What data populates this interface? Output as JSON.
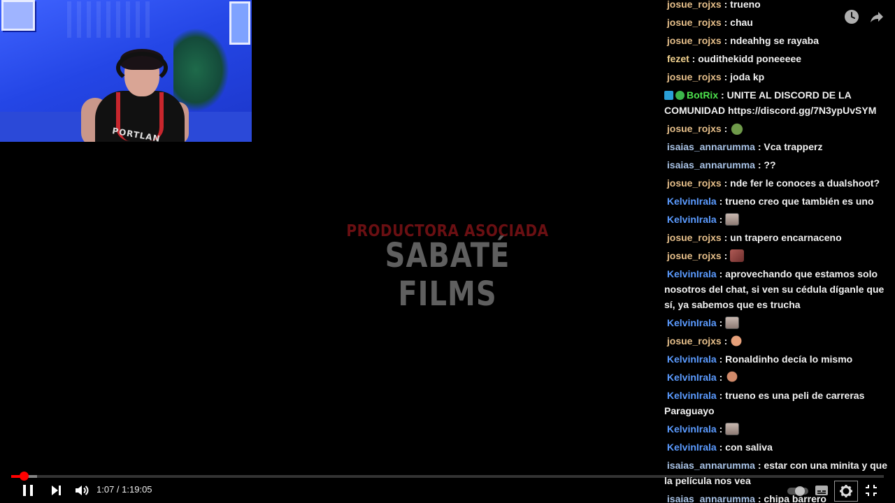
{
  "player": {
    "time_current": "1:07",
    "time_separator": " / ",
    "time_total": "1:19:05",
    "progress_played_fraction": 0.0147,
    "progress_loaded_fraction": 0.03
  },
  "video": {
    "logo_top": "PRODUCTORA ASOCIADA",
    "logo_main": "SABATÉ FILMS",
    "webcam_jersey_text": "PORTLAN"
  },
  "chat": {
    "messages": [
      {
        "user": "josue_rojxs",
        "user_color": "#e6bf8a",
        "text": "trueno"
      },
      {
        "user": "josue_rojxs",
        "user_color": "#e6bf8a",
        "text": "chau"
      },
      {
        "user": "josue_rojxs",
        "user_color": "#e6bf8a",
        "text": "ndeahhg se rayaba"
      },
      {
        "user": "fezet",
        "user_color": "#f2d28f",
        "text": "oudithekidd poneeeee"
      },
      {
        "user": "josue_rojxs",
        "user_color": "#e6bf8a",
        "text": "joda kp"
      },
      {
        "user": "BotRix",
        "user_color": "#4de34d",
        "text": "UNITE AL DISCORD DE LA COMUNIDAD https://discord.gg/7N3ypUvSYM",
        "badges": true
      },
      {
        "user": "josue_rojxs",
        "user_color": "#e6bf8a",
        "text": "",
        "emote": "frog"
      },
      {
        "user": "isaias_annarumma",
        "user_color": "#a9c3e6",
        "text": "Vca trapperz"
      },
      {
        "user": "isaias_annarumma",
        "user_color": "#a9c3e6",
        "text": "??"
      },
      {
        "user": "josue_rojxs",
        "user_color": "#e6bf8a",
        "text": "nde fer le conoces a dualshoot?"
      },
      {
        "user": "KelvinIrala",
        "user_color": "#5b9bff",
        "text": "trueno creo que también es uno"
      },
      {
        "user": "KelvinIrala",
        "user_color": "#5b9bff",
        "text": "",
        "emote": "face"
      },
      {
        "user": "josue_rojxs",
        "user_color": "#e6bf8a",
        "text": "un trapero encarnaceno"
      },
      {
        "user": "josue_rojxs",
        "user_color": "#e6bf8a",
        "text": "",
        "emote": "pixel"
      },
      {
        "user": "KelvinIrala",
        "user_color": "#5b9bff",
        "text": "aprovechando que estamos solo nosotros del chat, si ven su cédula díganle que sí, ya sabemos que es trucha"
      },
      {
        "user": "KelvinIrala",
        "user_color": "#5b9bff",
        "text": "",
        "emote": "face"
      },
      {
        "user": "josue_rojxs",
        "user_color": "#e6bf8a",
        "text": "",
        "emote": "hand"
      },
      {
        "user": "KelvinIrala",
        "user_color": "#5b9bff",
        "text": "Ronaldinho decía lo mismo"
      },
      {
        "user": "KelvinIrala",
        "user_color": "#5b9bff",
        "text": "",
        "emote": "person"
      },
      {
        "user": "KelvinIrala",
        "user_color": "#5b9bff",
        "text": "trueno es una peli de carreras Paraguayo"
      },
      {
        "user": "KelvinIrala",
        "user_color": "#5b9bff",
        "text": "",
        "emote": "face"
      },
      {
        "user": "KelvinIrala",
        "user_color": "#5b9bff",
        "text": "con saliva"
      },
      {
        "user": "isaias_annarumma",
        "user_color": "#a9c3e6",
        "text": "estar con una minita y que la película nos vea"
      },
      {
        "user": "isaias_annarumma",
        "user_color": "#a9c3e6",
        "text": "chipa barrero"
      }
    ]
  },
  "icons": {
    "watch_later": "clock-icon",
    "share": "share-icon",
    "play_pause": "pause-icon",
    "next": "next-icon",
    "volume": "volume-icon",
    "subtitles": "subtitles-icon",
    "settings": "gear-icon",
    "fullscreen_exit": "exit-fullscreen-icon",
    "autoplay": "autoplay-toggle-icon"
  },
  "colors": {
    "progress_red": "#ff0000",
    "username_gold": "#e6bf8a",
    "username_blue": "#5b9bff",
    "username_lightblue": "#a9c3e6",
    "botrix_green": "#4de34d"
  }
}
